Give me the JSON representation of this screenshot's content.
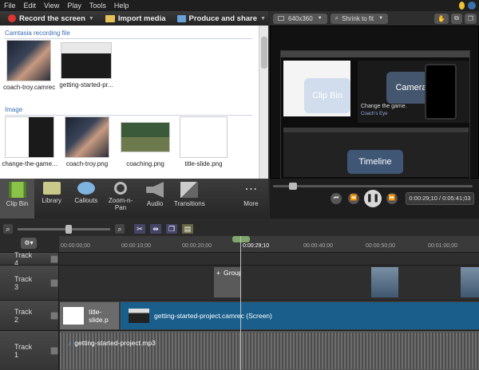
{
  "menu": {
    "items": [
      "File",
      "Edit",
      "View",
      "Play",
      "Tools",
      "Help"
    ]
  },
  "toolbar": {
    "record": "Record the screen",
    "import": "Import media",
    "produce": "Produce and share"
  },
  "clipbin": {
    "section1": "Camtasia recording file",
    "recordings": [
      {
        "label": "coach-troy.camrec"
      },
      {
        "label": "getting-started-pr..."
      }
    ],
    "section2": "Image",
    "images": [
      {
        "label": "change-the-game..."
      },
      {
        "label": "coach-troy.png"
      },
      {
        "label": "coaching.png"
      },
      {
        "label": "title-slide.png"
      }
    ]
  },
  "tabs": [
    {
      "label": "Clip Bin",
      "icon": "film-icon"
    },
    {
      "label": "Library",
      "icon": "folder-icon"
    },
    {
      "label": "Callouts",
      "icon": "speech-bubble-icon"
    },
    {
      "label": "Zoom-n-\nPan",
      "icon": "magnifier-icon"
    },
    {
      "label": "Audio",
      "icon": "speaker-icon"
    },
    {
      "label": "Transitions",
      "icon": "transition-icon"
    },
    {
      "label": "More",
      "icon": "dots-icon"
    }
  ],
  "preview": {
    "dimensions": "640x360",
    "fit": "Shrink to fit",
    "stage_clip_bin": "Clip Bin",
    "stage_camera": "Camera",
    "stage_timeline": "Timeline",
    "stage_tagline": "Change the game.",
    "stage_logo": "Coach's Eye"
  },
  "player": {
    "time": "0:00:29;10 / 0:05:41;03"
  },
  "timeline": {
    "ticks": [
      "00:00:00;00",
      "00:00:10;00",
      "00:00:20;00",
      "0:00:29;10",
      "00:00:40;00",
      "00:00:50;00",
      "00:01:00;00"
    ],
    "tracks": [
      {
        "name": "Track 4"
      },
      {
        "name": "Track 3"
      },
      {
        "name": "Track 2"
      },
      {
        "name": "Track 1"
      }
    ],
    "group_label": "Group",
    "clip_title": "title-slide.p",
    "clip_screen": "getting-started-project.camrec (Screen)",
    "clip_audio": "getting-started-project.mp3"
  },
  "colors": {
    "record": "#d9372f",
    "accent": "#3a6fb0",
    "clip_blue": "#1a5f8c",
    "playhead_green": "#7fa66d"
  }
}
